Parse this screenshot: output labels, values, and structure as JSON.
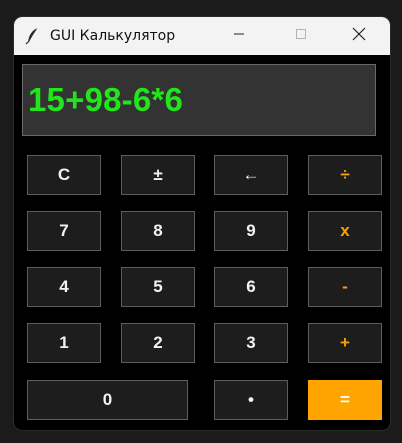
{
  "window": {
    "title": "GUI Калькулятор",
    "icon": "feather-icon",
    "controls": [
      "minimize-icon",
      "maximize-icon",
      "close-icon"
    ]
  },
  "display": {
    "value": "15+98-6*6",
    "color": "#22e51c"
  },
  "keys": {
    "clear": "C",
    "plus_minus": "±",
    "backspace": "←",
    "divide": "÷",
    "seven": "7",
    "eight": "8",
    "nine": "9",
    "multiply": "x",
    "four": "4",
    "five": "5",
    "six": "6",
    "subtract": "-",
    "one": "1",
    "two": "2",
    "three": "3",
    "add": "+",
    "zero": "0",
    "decimal": "•",
    "equals": "="
  },
  "colors": {
    "operator": "#f5a20a",
    "equals_bg": "#ffa400",
    "key_bg": "#1d1d1d",
    "window_bg": "#000000"
  }
}
